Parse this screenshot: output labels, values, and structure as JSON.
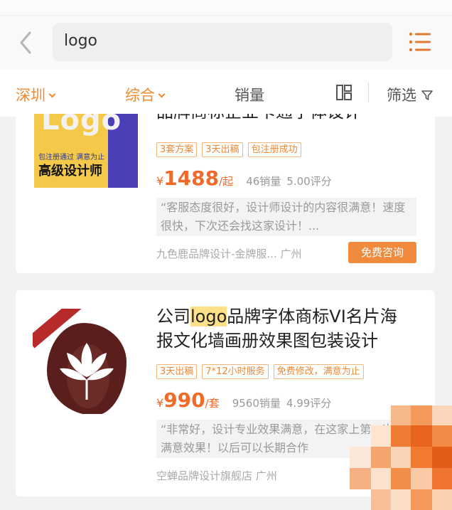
{
  "search": {
    "query": "logo"
  },
  "filters": {
    "city": "深圳",
    "sort": "综合",
    "sales": "销量",
    "screen": "筛选"
  },
  "products": [
    {
      "title": "品牌商标企业卡通字体设计",
      "thumb": {
        "logo_text": "Logo",
        "sub_text": "包注册通过  满意为止",
        "main_text": "高级设计师"
      },
      "tags": [
        "3套方案",
        "3天出稿",
        "包注册成功"
      ],
      "price_symbol": "¥",
      "price": "1488",
      "unit": "/起",
      "sales": "46销量",
      "rating": "5.00评分",
      "review": "“客服态度很好，设计师设计的内容很满意！速度很快，下次还会找这家设计！...",
      "shop": "九色鹿品牌设计-金牌服... 广州",
      "action": "免费咨询"
    },
    {
      "title_before": "公司",
      "title_highlight": "logo",
      "title_after": "品牌字体商标VI名片海报文化墙画册效果图包装设计",
      "tags": [
        "3天出稿",
        "7*12小时服务",
        "免费修改，满意为止"
      ],
      "price_symbol": "¥",
      "price": "990",
      "unit": "/套",
      "sales": "9560销量",
      "rating": "4.99评分",
      "review": "“非常好，设计专业效果满意，在这家上第一次有满意效果！以后可以长期合作",
      "shop": "空蝉品牌设计旗舰店 广州"
    }
  ]
}
